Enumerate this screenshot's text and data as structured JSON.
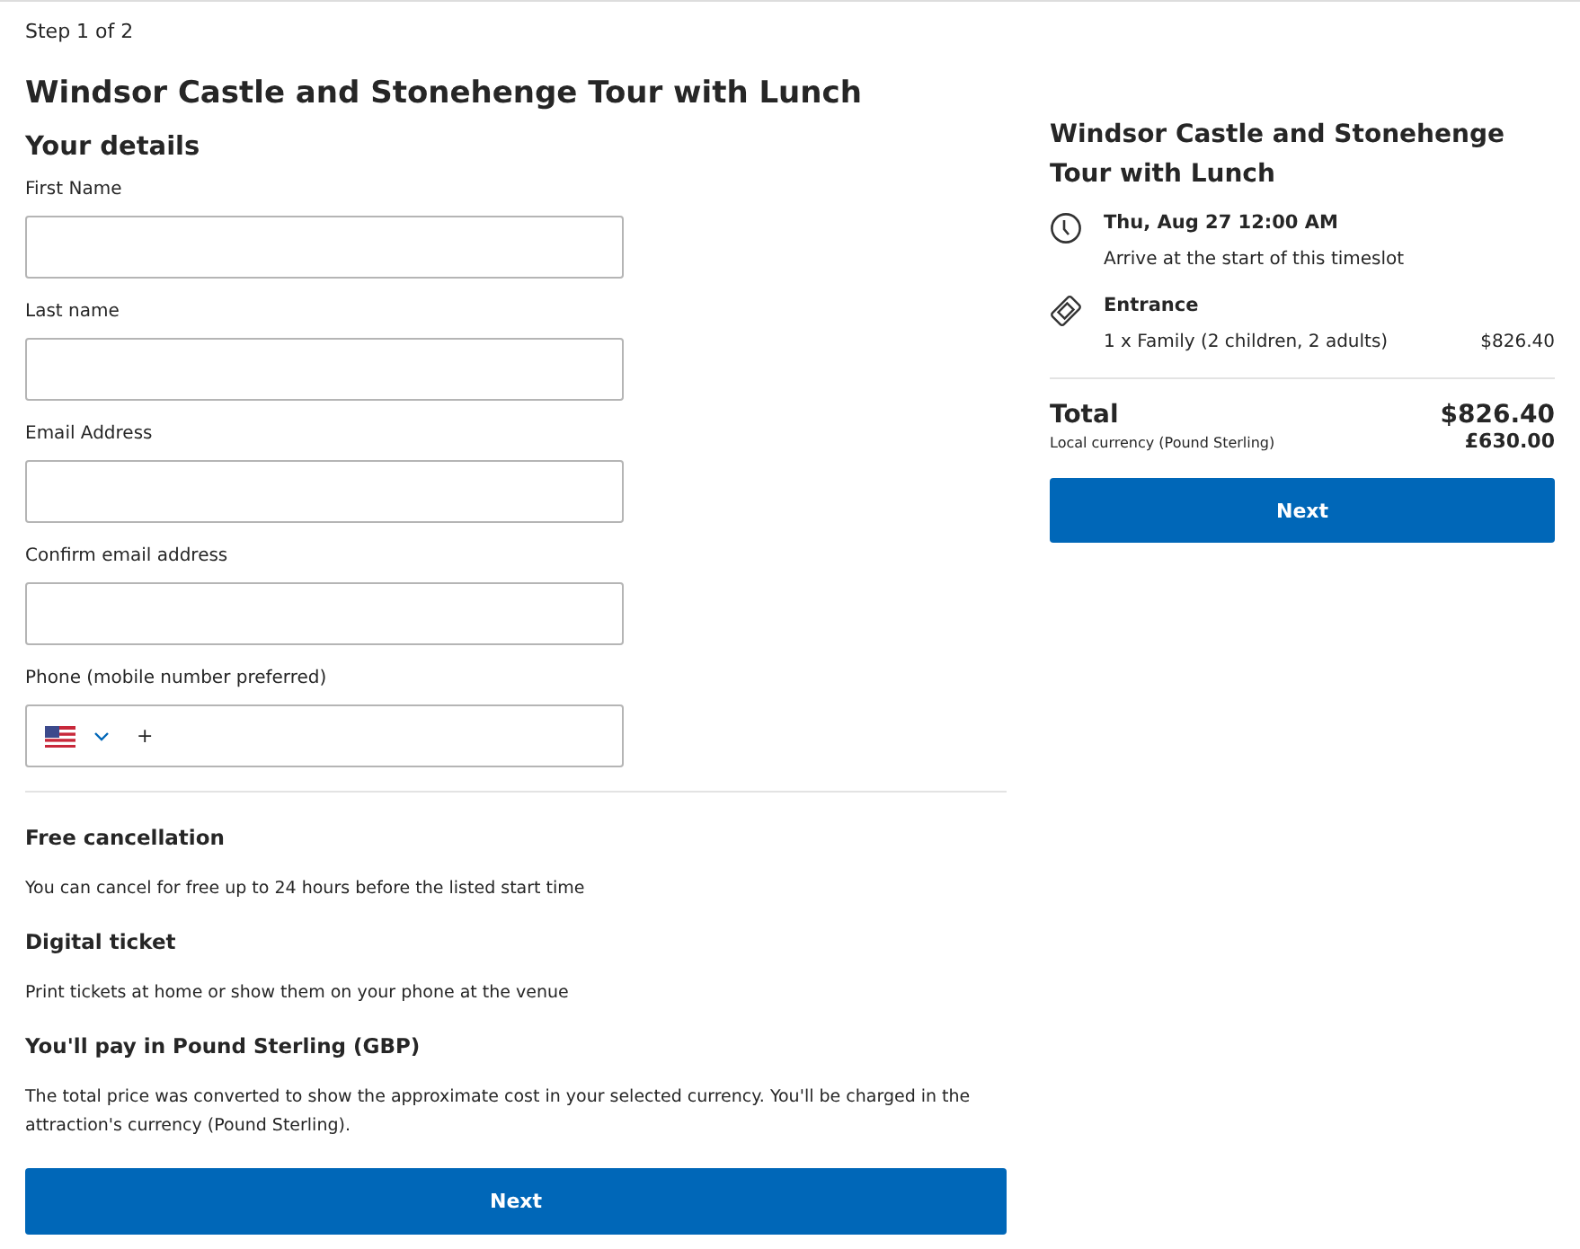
{
  "step": "Step 1 of 2",
  "title": "Windsor Castle and Stonehenge Tour with Lunch",
  "form": {
    "heading": "Your details",
    "fields": [
      {
        "kind": "text",
        "label": "First Name"
      },
      {
        "kind": "text",
        "label": "Last name"
      },
      {
        "kind": "text",
        "label": "Email Address"
      },
      {
        "kind": "text",
        "label": "Confirm email address"
      },
      {
        "kind": "phone",
        "label": "Phone (mobile number preferred)",
        "prefix": "+"
      }
    ]
  },
  "info": [
    {
      "heading": "Free cancellation",
      "text": "You can cancel for free up to 24 hours before the listed start time"
    },
    {
      "heading": "Digital ticket",
      "text": "Print tickets at home or show them on your phone at the venue"
    },
    {
      "heading": "You'll pay in Pound Sterling (GBP)",
      "text": "The total price was converted to show the approximate cost in your selected currency. You'll be charged in the attraction's currency (Pound Sterling)."
    }
  ],
  "next_button": "Next",
  "summary": {
    "title": "Windsor Castle and Stonehenge Tour with Lunch",
    "items": [
      {
        "kind": "time",
        "heading": "Thu, Aug 27 12:00 AM",
        "detail": "Arrive at the start of this timeslot"
      },
      {
        "kind": "ticket",
        "heading": "Entrance",
        "detail": "1 x Family (2 children, 2 adults)",
        "price": "$826.40"
      }
    ],
    "total_label": "Total",
    "total": "$826.40",
    "local_label": "Local currency (Pound Sterling)",
    "local_total": "£630.00",
    "next_button": "Next"
  }
}
